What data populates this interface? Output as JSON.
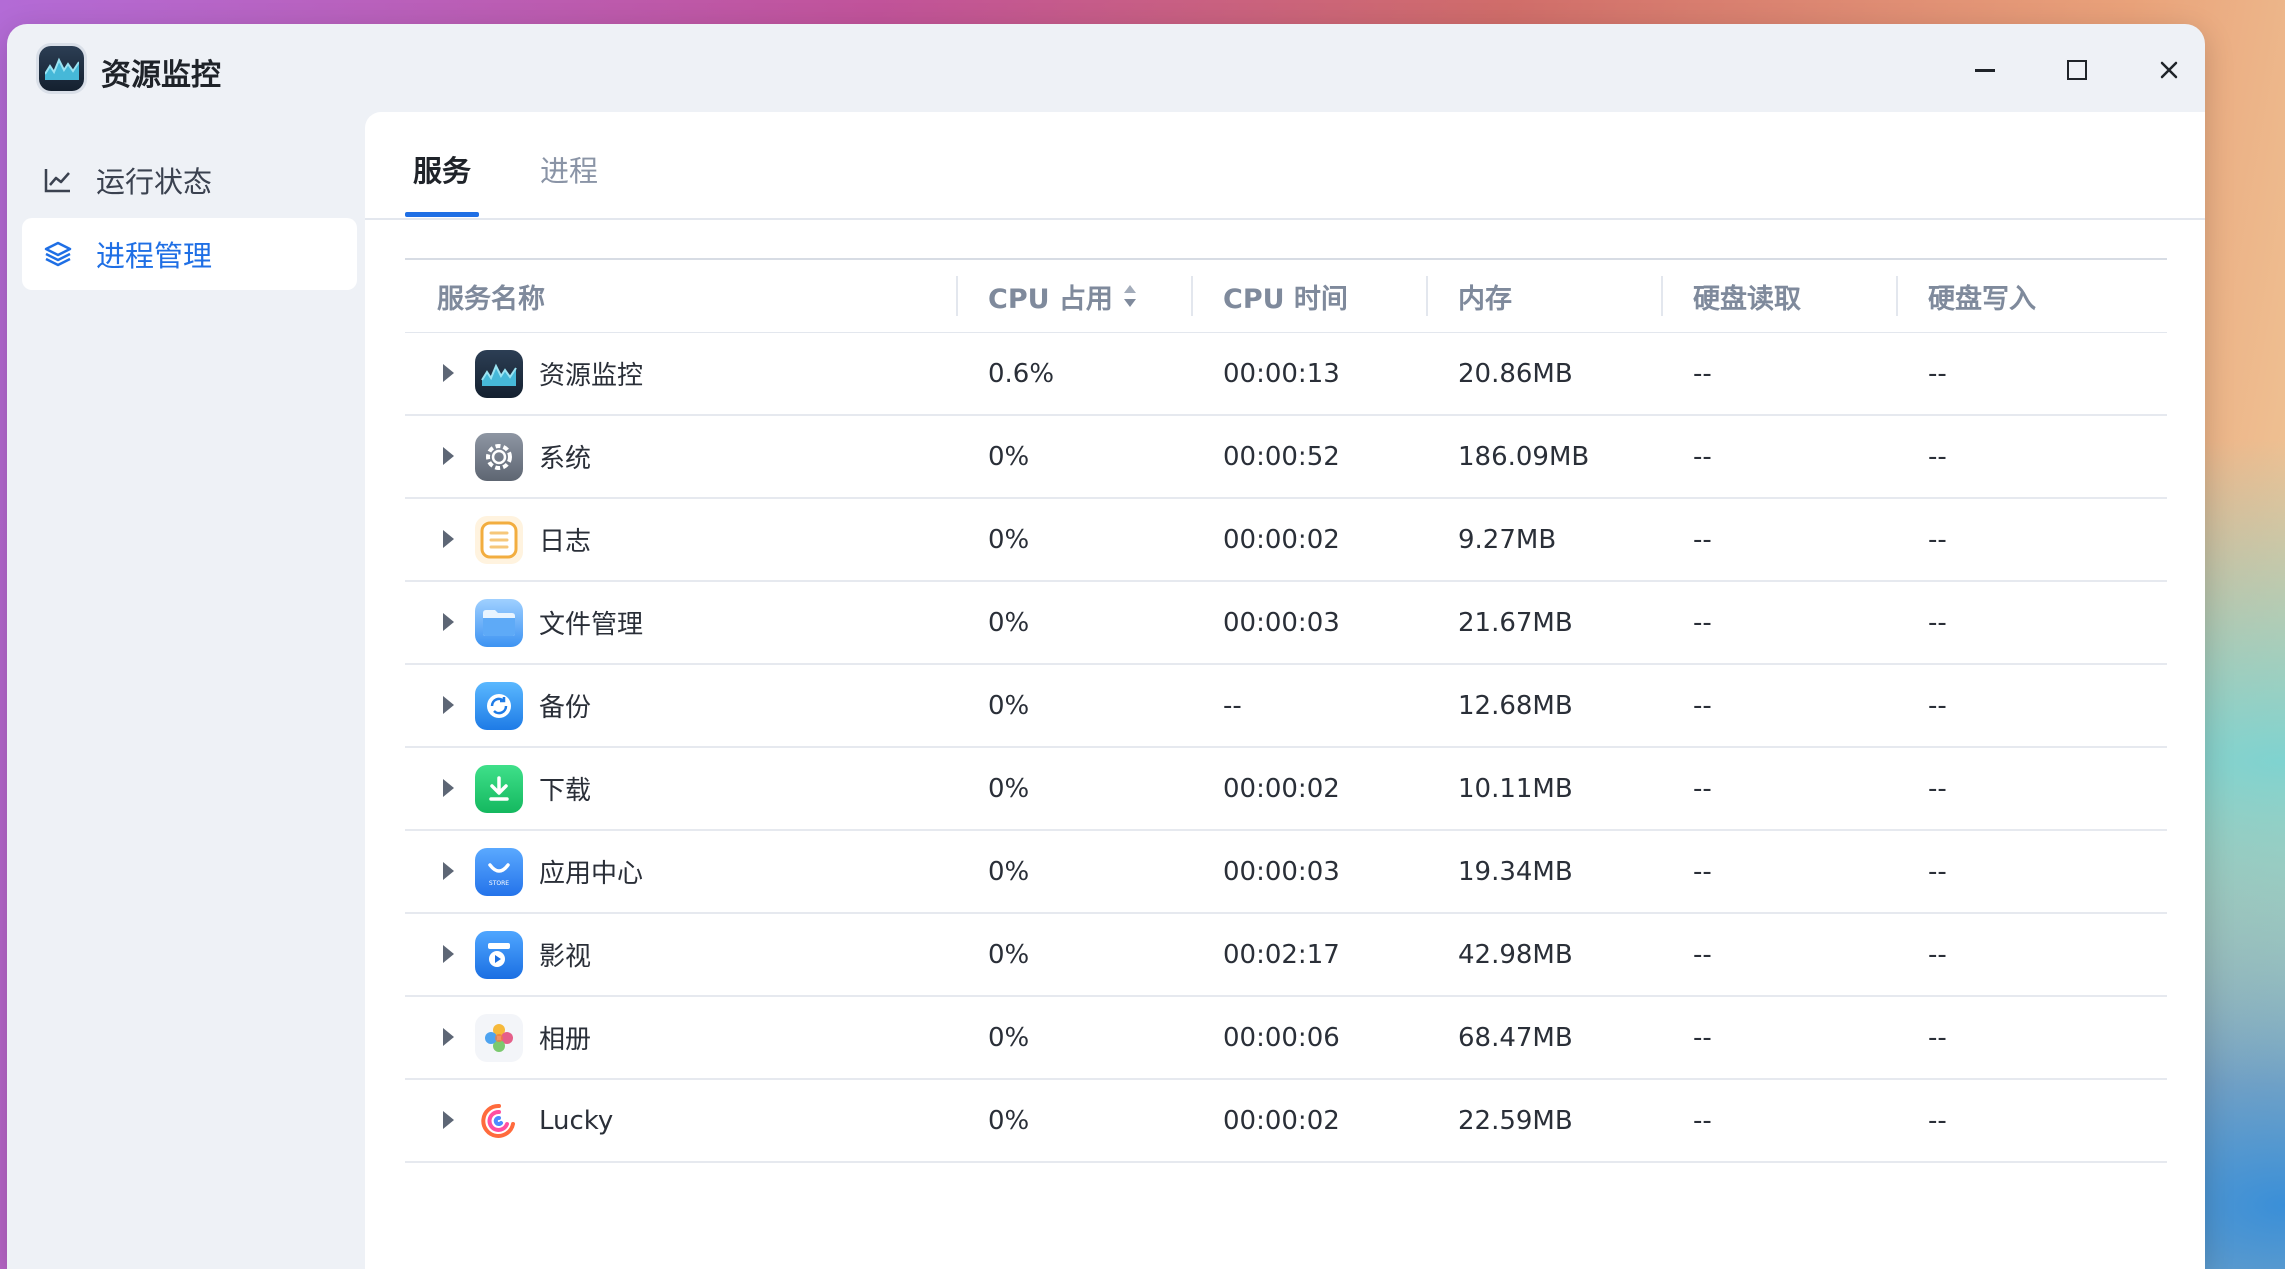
{
  "app": {
    "title": "资源监控",
    "icon": "resource-monitor-icon"
  },
  "window_controls": {
    "minimize": "minimize-icon",
    "maximize": "maximize-icon",
    "close": "close-icon"
  },
  "sidebar": {
    "items": [
      {
        "label": "运行状态",
        "icon": "line-chart-icon",
        "active": false
      },
      {
        "label": "进程管理",
        "icon": "layers-icon",
        "active": true
      }
    ]
  },
  "tabs": [
    {
      "label": "服务",
      "active": true
    },
    {
      "label": "进程",
      "active": false
    }
  ],
  "table": {
    "columns": [
      "服务名称",
      "CPU 占用",
      "CPU 时间",
      "内存",
      "硬盘读取",
      "硬盘写入"
    ],
    "sort_column": "CPU 占用",
    "rows": [
      {
        "name": "资源监控",
        "icon": "resource-monitor-icon",
        "cpu": "0.6%",
        "time": "00:00:13",
        "mem": "20.86MB",
        "read": "--",
        "write": "--"
      },
      {
        "name": "系统",
        "icon": "system-gear-icon",
        "cpu": "0%",
        "time": "00:00:52",
        "mem": "186.09MB",
        "read": "--",
        "write": "--"
      },
      {
        "name": "日志",
        "icon": "log-list-icon",
        "cpu": "0%",
        "time": "00:00:02",
        "mem": "9.27MB",
        "read": "--",
        "write": "--"
      },
      {
        "name": "文件管理",
        "icon": "folder-icon",
        "cpu": "0%",
        "time": "00:00:03",
        "mem": "21.67MB",
        "read": "--",
        "write": "--"
      },
      {
        "name": "备份",
        "icon": "backup-sync-icon",
        "cpu": "0%",
        "time": "--",
        "mem": "12.68MB",
        "read": "--",
        "write": "--"
      },
      {
        "name": "下载",
        "icon": "download-icon",
        "cpu": "0%",
        "time": "00:00:02",
        "mem": "10.11MB",
        "read": "--",
        "write": "--"
      },
      {
        "name": "应用中心",
        "icon": "app-store-icon",
        "cpu": "0%",
        "time": "00:00:03",
        "mem": "19.34MB",
        "read": "--",
        "write": "--"
      },
      {
        "name": "影视",
        "icon": "video-icon",
        "cpu": "0%",
        "time": "00:02:17",
        "mem": "42.98MB",
        "read": "--",
        "write": "--"
      },
      {
        "name": "相册",
        "icon": "photos-flower-icon",
        "cpu": "0%",
        "time": "00:00:06",
        "mem": "68.47MB",
        "read": "--",
        "write": "--"
      },
      {
        "name": "Lucky",
        "icon": "lucky-swirl-icon",
        "cpu": "0%",
        "time": "00:00:02",
        "mem": "22.59MB",
        "read": "--",
        "write": "--"
      }
    ]
  },
  "colors": {
    "accent": "#1f6fe5",
    "window_bg": "#eef1f6",
    "content_bg": "#ffffff"
  }
}
